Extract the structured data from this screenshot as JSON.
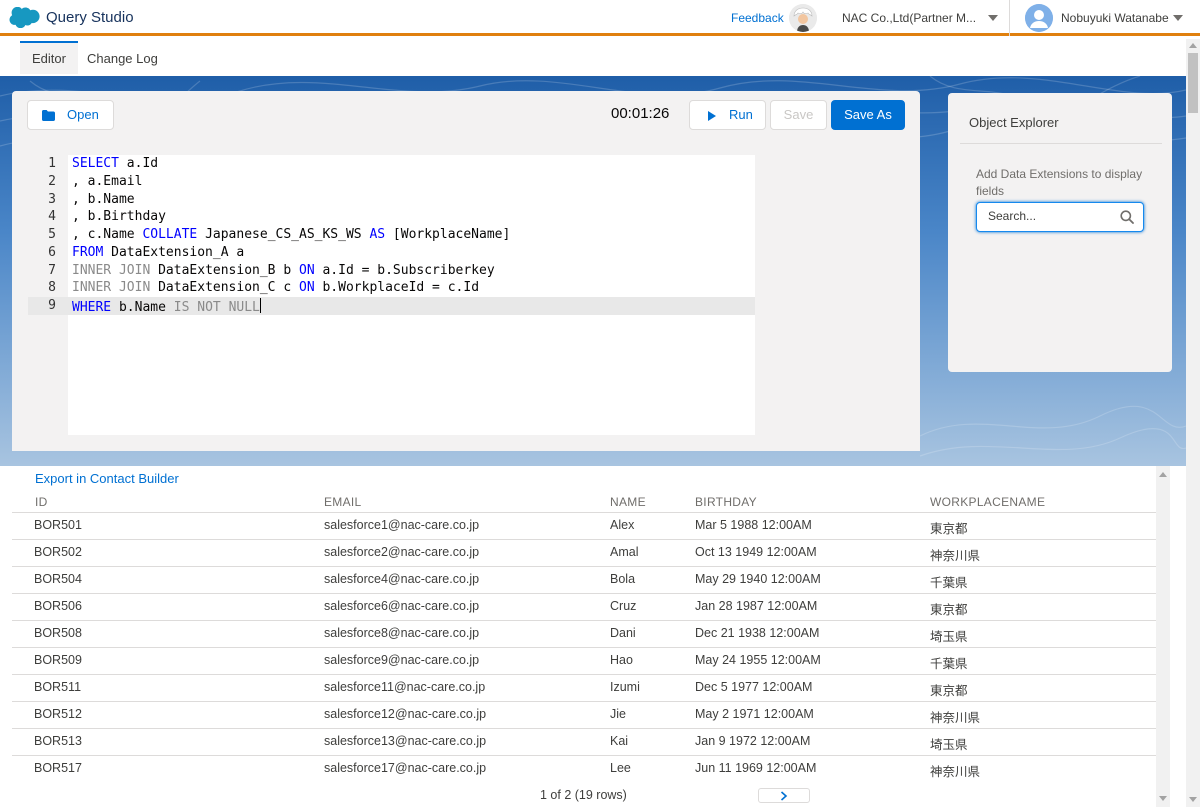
{
  "header": {
    "app_title": "Query Studio",
    "feedback": "Feedback",
    "org_name": "NAC Co.,Ltd(Partner M...",
    "user_name": "Nobuyuki Watanabe"
  },
  "tabs": [
    {
      "label": "Editor",
      "active": true
    },
    {
      "label": "Change Log",
      "active": false
    }
  ],
  "toolbar": {
    "open_label": "Open",
    "timer": "00:01:26",
    "run_label": "Run",
    "save_label": "Save",
    "save_as_label": "Save As"
  },
  "editor": {
    "line_numbers": [
      "1",
      "2",
      "3",
      "4",
      "5",
      "6",
      "7",
      "8",
      "9"
    ],
    "lines": [
      "SELECT a.Id",
      ", a.Email",
      ", b.Name",
      ", b.Birthday",
      ", c.Name COLLATE Japanese_CS_AS_KS_WS AS [WorkplaceName]",
      "FROM DataExtension_A a",
      "INNER JOIN DataExtension_B b ON a.Id = b.Subscriberkey",
      "INNER JOIN DataExtension_C c ON b.WorkplaceId = c.Id",
      "WHERE b.Name IS NOT NULL"
    ],
    "active_line": 9
  },
  "explorer": {
    "title": "Object Explorer",
    "hint": "Add Data Extensions to display fields",
    "search_placeholder": "Search..."
  },
  "results": {
    "export_label": "Export in Contact Builder",
    "columns": [
      "ID",
      "EMAIL",
      "NAME",
      "BIRTHDAY",
      "WORKPLACENAME"
    ],
    "rows": [
      [
        "BOR501",
        "salesforce1@nac-care.co.jp",
        "Alex",
        "Mar 5 1988 12:00AM",
        "東京都"
      ],
      [
        "BOR502",
        "salesforce2@nac-care.co.jp",
        "Amal",
        "Oct 13 1949 12:00AM",
        "神奈川県"
      ],
      [
        "BOR504",
        "salesforce4@nac-care.co.jp",
        "Bola",
        "May 29 1940 12:00AM",
        "千葉県"
      ],
      [
        "BOR506",
        "salesforce6@nac-care.co.jp",
        "Cruz",
        "Jan 28 1987 12:00AM",
        "東京都"
      ],
      [
        "BOR508",
        "salesforce8@nac-care.co.jp",
        "Dani",
        "Dec 21 1938 12:00AM",
        "埼玉県"
      ],
      [
        "BOR509",
        "salesforce9@nac-care.co.jp",
        "Hao",
        "May 24 1955 12:00AM",
        "千葉県"
      ],
      [
        "BOR511",
        "salesforce11@nac-care.co.jp",
        "Izumi",
        "Dec 5 1977 12:00AM",
        "東京都"
      ],
      [
        "BOR512",
        "salesforce12@nac-care.co.jp",
        "Jie",
        "May 2 1971 12:00AM",
        "神奈川県"
      ],
      [
        "BOR513",
        "salesforce13@nac-care.co.jp",
        "Kai",
        "Jan 9 1972 12:00AM",
        "埼玉県"
      ],
      [
        "BOR517",
        "salesforce17@nac-care.co.jp",
        "Lee",
        "Jun 11 1969 12:00AM",
        "神奈川県"
      ]
    ],
    "pager_text": "1 of 2 (19 rows)"
  },
  "colors": {
    "accent": "#0070d2",
    "header_border": "#e0800e"
  }
}
